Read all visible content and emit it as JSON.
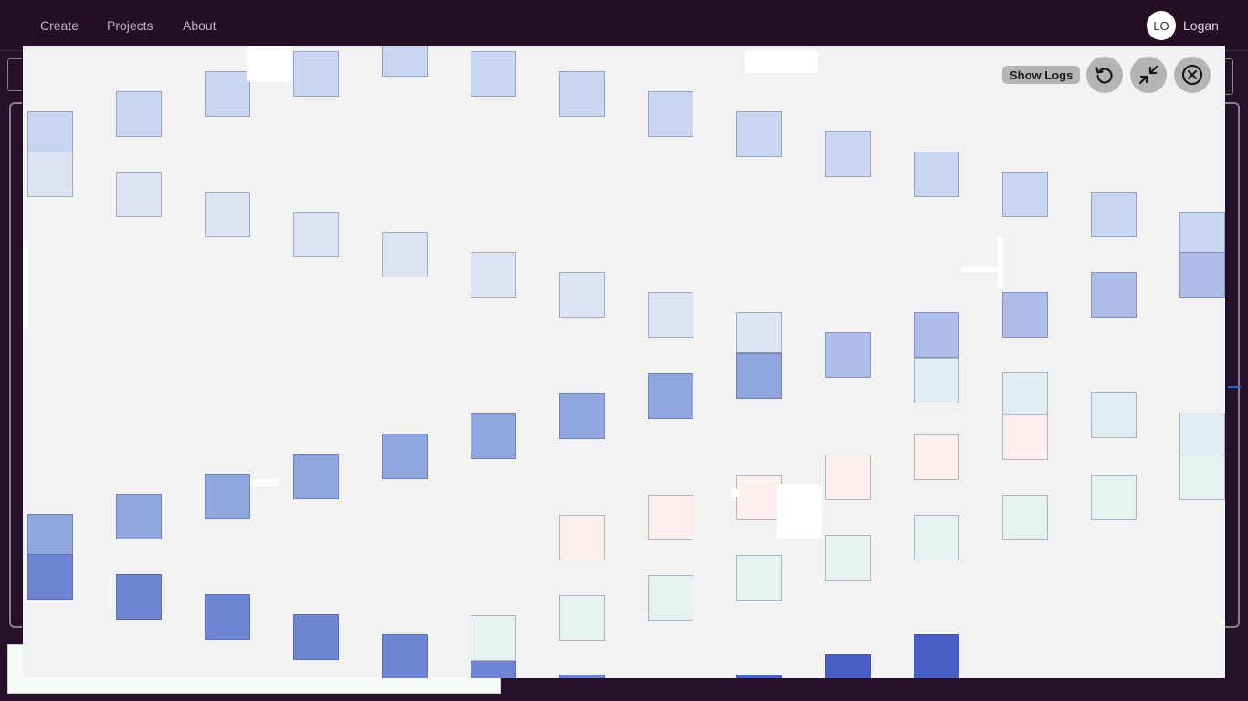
{
  "nav": {
    "links": [
      "Create",
      "Projects",
      "About"
    ]
  },
  "user": {
    "initials": "LO",
    "name": "Logan"
  },
  "viewer": {
    "show_logs_label": "Show Logs",
    "controls": [
      {
        "name": "restart-button",
        "icon": "restart-icon"
      },
      {
        "name": "minimize-button",
        "icon": "minimize-icon"
      },
      {
        "name": "close-button",
        "icon": "close-icon"
      }
    ],
    "colors": {
      "background": "#f2f2f2",
      "light_blue": "#c8d6f0",
      "mid_blue": "#9aaee0",
      "dark_blue": "#4a5ec8",
      "pale_cyan": "#e2eef0",
      "pale_pink": "#fbeeee"
    }
  }
}
